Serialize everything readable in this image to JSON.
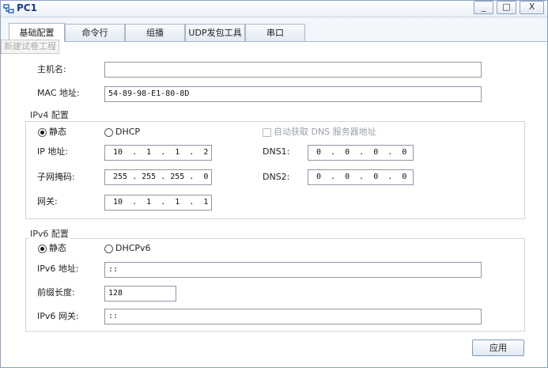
{
  "window": {
    "title": "PC1"
  },
  "titlebar_buttons": {
    "minimize": "_",
    "maximize": "□",
    "close": "X"
  },
  "tabs": [
    {
      "label": "基础配置"
    },
    {
      "label": "命令行"
    },
    {
      "label": "组播"
    },
    {
      "label": "UDP发包工具"
    },
    {
      "label": "串口"
    }
  ],
  "tooltip": "新建试卷工程",
  "host": {
    "hostname_label": "主机名:",
    "hostname_value": "",
    "mac_label": "MAC 地址:",
    "mac_value": "54-89-98-E1-80-8D"
  },
  "ipv4": {
    "title": "IPv4 配置",
    "static_label": "静态",
    "dhcp_label": "DHCP",
    "auto_dns_label": "自动获取 DNS 服务器地址",
    "ip_label": "IP 地址:",
    "ip_value": "10  .  1  .  1  .  2",
    "mask_label": "子网掩码:",
    "mask_value": "255 . 255 . 255 .  0",
    "gateway_label": "网关:",
    "gateway_value": "10  .  1  .  1  .  1",
    "dns1_label": "DNS1:",
    "dns1_value": "0  .  0  .  0  .  0",
    "dns2_label": "DNS2:",
    "dns2_value": "0  .  0  .  0  .  0"
  },
  "ipv6": {
    "title": "IPv6 配置",
    "static_label": "静态",
    "dhcp_label": "DHCPv6",
    "addr_label": "IPv6 地址:",
    "addr_value": "::",
    "prefix_label": "前缀长度:",
    "prefix_value": "128",
    "gateway_label": "IPv6 网关:",
    "gateway_value": "::"
  },
  "apply_label": "应用"
}
